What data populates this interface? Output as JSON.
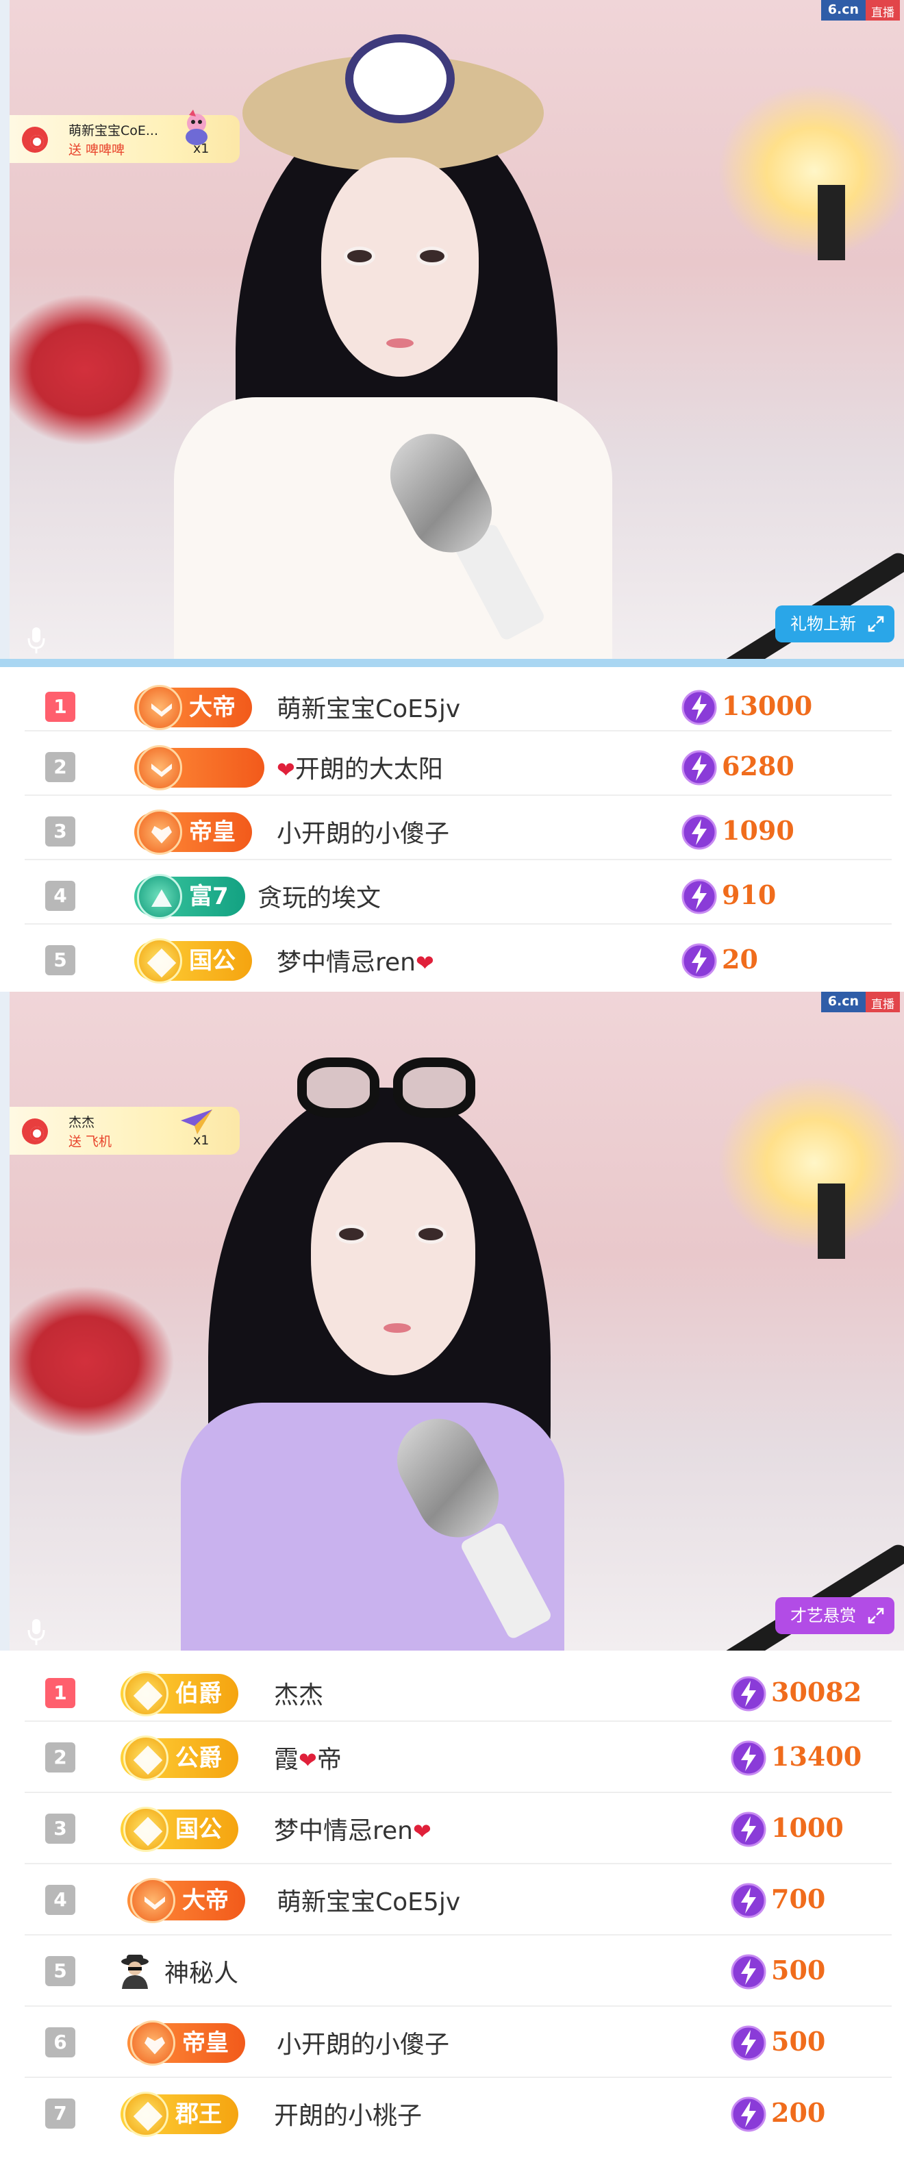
{
  "panel1": {
    "brand": {
      "domain": "6.cn",
      "tag": "直播"
    },
    "gift_notice": {
      "user": "萌新宝宝CoE...",
      "action": "送 啤啤啤",
      "count": "x1"
    },
    "corner_button": "礼物上新",
    "icons": {
      "mic": "microphone-icon",
      "expand": "expand-icon",
      "gift": "gift-icon",
      "avatar": "user-avatar-icon"
    },
    "rows": [
      {
        "rank": "1",
        "title": "大帝",
        "name": "萌新宝宝CoE5jv",
        "score": "13000"
      },
      {
        "rank": "2",
        "title": "",
        "name": "开朗的大太阳",
        "score": "6280"
      },
      {
        "rank": "3",
        "title": "帝皇",
        "name": "小开朗的小傻子",
        "score": "1090"
      },
      {
        "rank": "4",
        "title": "富7",
        "name": "贪玩的埃文",
        "score": "910"
      },
      {
        "rank": "5",
        "title": "国公",
        "name": "梦中情忌ren",
        "score": "20"
      }
    ]
  },
  "panel2": {
    "brand": {
      "domain": "6.cn",
      "tag": "直播"
    },
    "gift_notice": {
      "user": "杰杰",
      "action": "送 飞机",
      "count": "x1"
    },
    "corner_button": "才艺悬赏",
    "rows": [
      {
        "rank": "1",
        "title": "伯爵",
        "name": "杰杰",
        "score": "30082"
      },
      {
        "rank": "2",
        "title": "公爵",
        "name_a": "霞",
        "name_b": "帝",
        "score": "13400"
      },
      {
        "rank": "3",
        "title": "国公",
        "name": "梦中情忌ren",
        "score": "1000"
      },
      {
        "rank": "4",
        "title": "大帝",
        "name": "萌新宝宝CoE5jv",
        "score": "700"
      },
      {
        "rank": "5",
        "title": "",
        "name": "神秘人",
        "score": "500"
      },
      {
        "rank": "6",
        "title": "帝皇",
        "name": "小开朗的小傻子",
        "score": "500"
      },
      {
        "rank": "7",
        "title": "郡王",
        "name": "开朗的小桃子",
        "score": "200"
      }
    ]
  },
  "colors": {
    "rank_first": "#ff5f6d",
    "rank_other": "#b8b8b8",
    "score": "#f06c1c",
    "bolt": "#8a3bd8",
    "accent_blue": "#2aa6e8",
    "accent_purple": "#b24ce6"
  }
}
